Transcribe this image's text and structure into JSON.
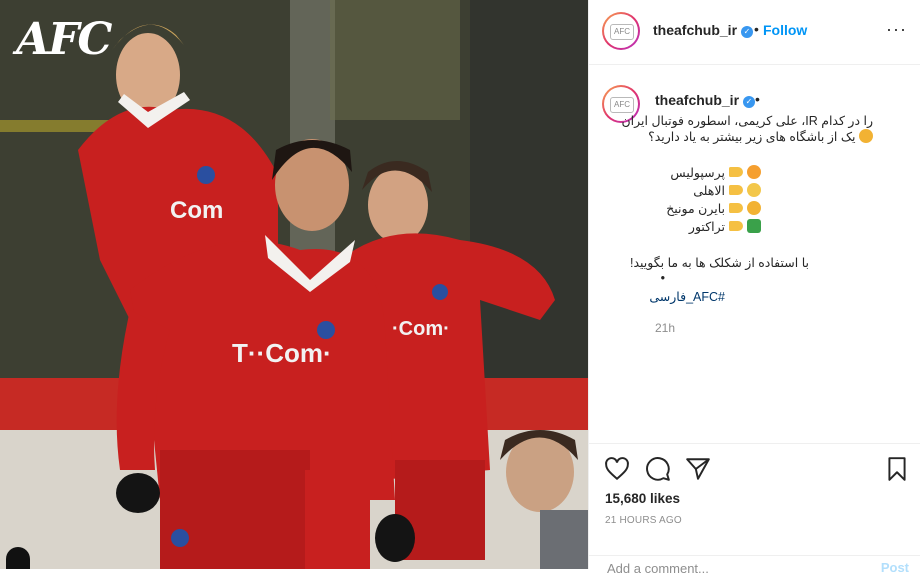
{
  "photo": {
    "logo_text": "AFC"
  },
  "header": {
    "username": "theafchub_ir",
    "verified_icon": "verified-badge-icon",
    "separator": "•",
    "follow_label": "Follow",
    "more_label": "···"
  },
  "caption": {
    "username": "theafchub_ir",
    "separator": "•",
    "line1": "را در کدام IR، علی کریمی، اسطوره فوتبال ایران",
    "line2": "یک از باشگاه های زیر بیشتر به یاد دارید؟",
    "options": [
      {
        "text": "پرسپولیس",
        "emoji_color": "#f59f2f"
      },
      {
        "text": "الاهلی",
        "emoji_color": "#f3c74a"
      },
      {
        "text": "بایرن مونیخ",
        "emoji_color": "#f2b233"
      },
      {
        "text": "تراکتور",
        "emoji_color": "#3aa14a"
      }
    ],
    "prompt": "با استفاده از شکلک ها به ما بگویید!",
    "bullet": "•",
    "hashtag": "#AFC_فارسی",
    "time": "21h"
  },
  "actions": {
    "icons": [
      "heart-icon",
      "comment-icon",
      "share-icon",
      "bookmark-icon"
    ],
    "likes": "15,680 likes",
    "posted_ago": "21 HOURS AGO",
    "comment_placeholder": "Add a comment...",
    "post_label": "Post"
  },
  "colors": {
    "link_blue": "#0095f6",
    "jersey_red": "#c8201f",
    "muted_gray": "#8e8e8e"
  }
}
